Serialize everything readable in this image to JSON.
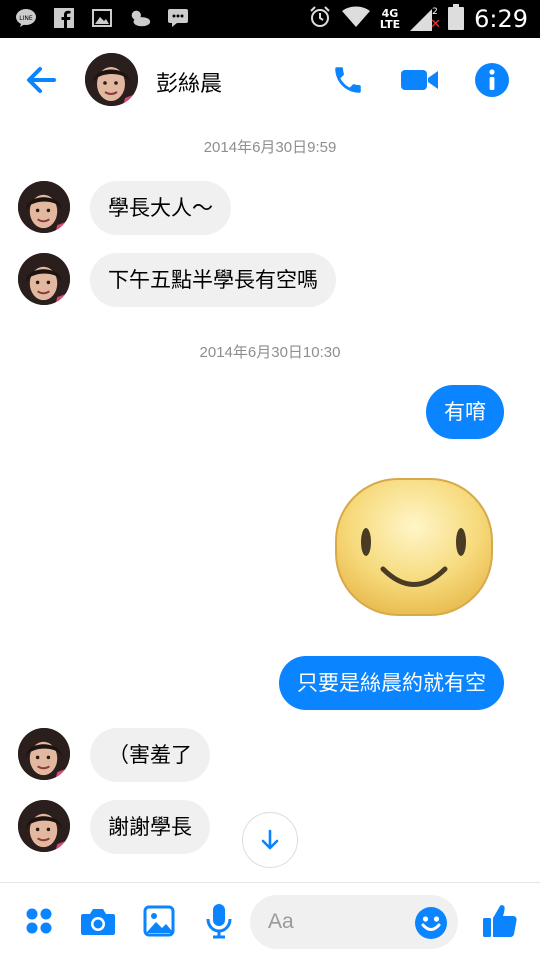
{
  "status_bar": {
    "network": "4G",
    "network_sub": "LTE",
    "sim_badge": "2",
    "time": "6:29",
    "icons": [
      "line-app-icon",
      "facebook-icon",
      "gallery-icon",
      "weather-icon",
      "messenger-icon",
      "alarm-icon",
      "wifi-icon",
      "signal-icon",
      "battery-icon"
    ]
  },
  "header": {
    "contact_name": "彭絲晨",
    "icons": [
      "back-arrow-icon",
      "phone-icon",
      "video-camera-icon",
      "info-icon"
    ]
  },
  "conversation": {
    "timestamp_1": "2014年6月30日9:59",
    "timestamp_2": "2014年6月30日10:30",
    "messages": [
      {
        "direction": "incoming",
        "text": "學長大人～"
      },
      {
        "direction": "incoming",
        "text": "下午五點半學長有空嗎"
      },
      {
        "direction": "outgoing",
        "text": "有唷"
      },
      {
        "direction": "outgoing",
        "sticker": "smiley-face-sticker"
      },
      {
        "direction": "outgoing",
        "text": "只要是絲晨約就有空"
      },
      {
        "direction": "incoming",
        "text": "（害羞了"
      },
      {
        "direction": "incoming",
        "text": "謝謝學長"
      }
    ]
  },
  "composer": {
    "placeholder": "Aa",
    "icons": [
      "apps-grid-icon",
      "camera-icon",
      "image-icon",
      "microphone-icon",
      "emoji-icon",
      "thumbs-up-icon"
    ]
  },
  "colors": {
    "accent": "#0a84ff",
    "incoming_bubble": "#f0f0f0",
    "timestamp": "#8e8e93",
    "status_bar": "#000000"
  }
}
